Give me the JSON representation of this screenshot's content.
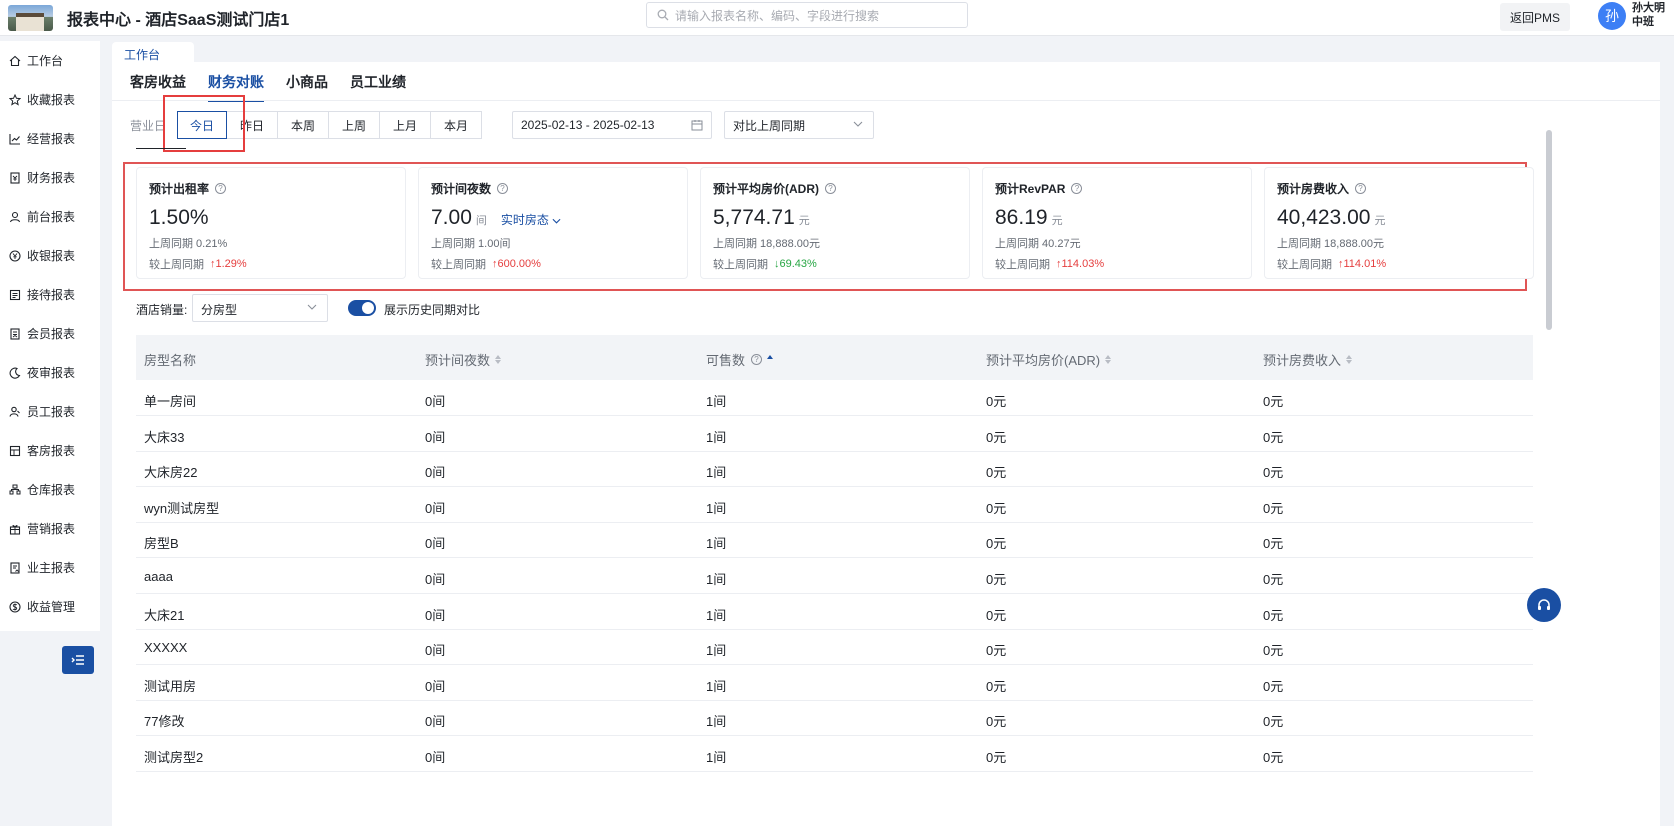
{
  "header": {
    "title": "报表中心 - 酒店SaaS测试门店1",
    "search_placeholder": "请输入报表名称、编码、字段进行搜索",
    "back_button": "返回PMS",
    "avatar_initial": "孙",
    "user_name": "孙大明",
    "user_shift": "中班"
  },
  "sidebar": {
    "items": [
      {
        "label": "工作台",
        "icon": "home-icon"
      },
      {
        "label": "收藏报表",
        "icon": "star-icon"
      },
      {
        "label": "经营报表",
        "icon": "trend-chart-icon"
      },
      {
        "label": "财务报表",
        "icon": "finance-doc-icon"
      },
      {
        "label": "前台报表",
        "icon": "person-icon"
      },
      {
        "label": "收银报表",
        "icon": "yen-coin-icon"
      },
      {
        "label": "接待报表",
        "icon": "reception-list-icon"
      },
      {
        "label": "会员报表",
        "icon": "member-card-icon"
      },
      {
        "label": "夜审报表",
        "icon": "moon-icon"
      },
      {
        "label": "员工报表",
        "icon": "staff-icon"
      },
      {
        "label": "客房报表",
        "icon": "room-icon"
      },
      {
        "label": "仓库报表",
        "icon": "warehouse-icon"
      },
      {
        "label": "营销报表",
        "icon": "gift-icon"
      },
      {
        "label": "业主报表",
        "icon": "owner-doc-icon"
      },
      {
        "label": "收益管理",
        "icon": "dollar-coin-icon"
      }
    ]
  },
  "workspace_tab": "工作台",
  "main_tabs": [
    "客房收益",
    "财务对账",
    "小商品",
    "员工业绩"
  ],
  "filters": {
    "label": "营业日",
    "periods": [
      "今日",
      "昨日",
      "本周",
      "上周",
      "上月",
      "本月"
    ],
    "active_period": "今日",
    "date_range": "2025-02-13 - 2025-02-13",
    "compare": "对比上周同期"
  },
  "kpis": [
    {
      "title": "预计出租率",
      "value": "1.50%",
      "unit": "",
      "extra": "",
      "last": "上周同期 0.21%",
      "cmp_label": "较上周同期",
      "change": "1.29%",
      "trend": "up"
    },
    {
      "title": "预计间夜数",
      "value": "7.00",
      "unit": "间",
      "extra": "实时房态",
      "last": "上周同期 1.00间",
      "cmp_label": "较上周同期",
      "change": "600.00%",
      "trend": "up"
    },
    {
      "title": "预计平均房价(ADR)",
      "value": "5,774.71",
      "unit": "元",
      "extra": "",
      "last": "上周同期 18,888.00元",
      "cmp_label": "较上周同期",
      "change": "69.43%",
      "trend": "down"
    },
    {
      "title": "预计RevPAR",
      "value": "86.19",
      "unit": "元",
      "extra": "",
      "last": "上周同期 40.27元",
      "cmp_label": "较上周同期",
      "change": "114.03%",
      "trend": "up"
    },
    {
      "title": "预计房费收入",
      "value": "40,423.00",
      "unit": "元",
      "extra": "",
      "last": "上周同期 18,888.00元",
      "cmp_label": "较上周同期",
      "change": "114.01%",
      "trend": "up"
    }
  ],
  "sales": {
    "label": "酒店销量:",
    "group_by": "分房型",
    "toggle_label": "展示历史同期对比",
    "toggle_on": true
  },
  "table": {
    "columns": [
      "房型名称",
      "预计间夜数",
      "可售数",
      "预计平均房价(ADR)",
      "预计房费收入"
    ],
    "rows": [
      [
        "单一房间",
        "0间",
        "1间",
        "0元",
        "0元"
      ],
      [
        "大床33",
        "0间",
        "1间",
        "0元",
        "0元"
      ],
      [
        "大床房22",
        "0间",
        "1间",
        "0元",
        "0元"
      ],
      [
        "wyn测试房型",
        "0间",
        "1间",
        "0元",
        "0元"
      ],
      [
        "房型B",
        "0间",
        "1间",
        "0元",
        "0元"
      ],
      [
        "aaaa",
        "0间",
        "1间",
        "0元",
        "0元"
      ],
      [
        "大床21",
        "0间",
        "1间",
        "0元",
        "0元"
      ],
      [
        "XXXXX",
        "0间",
        "1间",
        "0元",
        "0元"
      ],
      [
        "测试用房",
        "0间",
        "1间",
        "0元",
        "0元"
      ],
      [
        "77修改",
        "0间",
        "1间",
        "0元",
        "0元"
      ],
      [
        "测试房型2",
        "0间",
        "1间",
        "0元",
        "0元"
      ]
    ]
  },
  "colors": {
    "primary": "#1a4fa3",
    "up": "#e53e3e",
    "down": "#27a644",
    "highlight": "#e05555"
  }
}
